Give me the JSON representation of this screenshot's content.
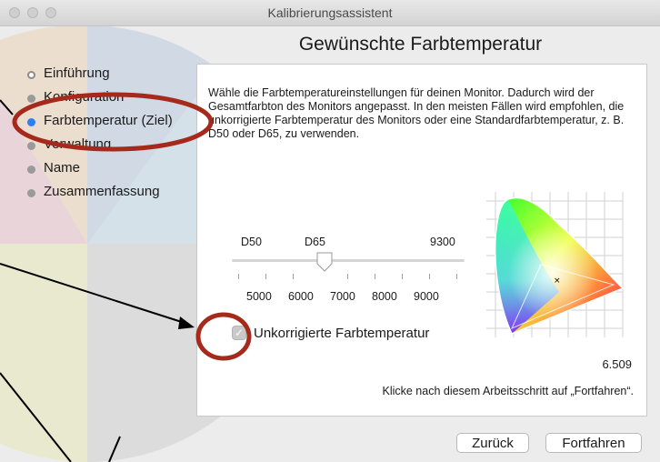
{
  "window": {
    "title": "Kalibrierungsassistent"
  },
  "heading": "Gewünschte Farbtemperatur",
  "steps": [
    {
      "label": "Einführung",
      "state": "done"
    },
    {
      "label": "Konfiguration",
      "state": "pending"
    },
    {
      "label": "Farbtemperatur (Ziel)",
      "state": "current"
    },
    {
      "label": "Verwaltung",
      "state": "pending"
    },
    {
      "label": "Name",
      "state": "pending"
    },
    {
      "label": "Zusammenfassung",
      "state": "pending"
    }
  ],
  "panel": {
    "description": "Wähle die Farbtemperatureinstellungen für deinen Monitor. Dadurch wird der Gesamtfarbton des Monitors angepasst. In den meisten Fällen wird empfohlen, die unkorrigierte Farbtemperatur des Monitors oder eine Standardfarbtemperatur, z. B. D50 oder D65, zu verwenden.",
    "slider": {
      "top_labels": [
        "D50",
        "D65",
        "9300"
      ],
      "bottom_labels": [
        "5000",
        "6000",
        "7000",
        "8000",
        "9000"
      ]
    },
    "checkbox": {
      "label": "Unkorrigierte Farbtemperatur",
      "checked": true
    },
    "temperature_value": "6.509",
    "hint": "Klicke nach diesem Arbeitsschritt auf „Fortfahren“."
  },
  "buttons": {
    "back": "Zurück",
    "continue": "Fortfahren"
  },
  "colors": {
    "accent": "#2f7ff0",
    "annotation": "#a52a1c"
  }
}
